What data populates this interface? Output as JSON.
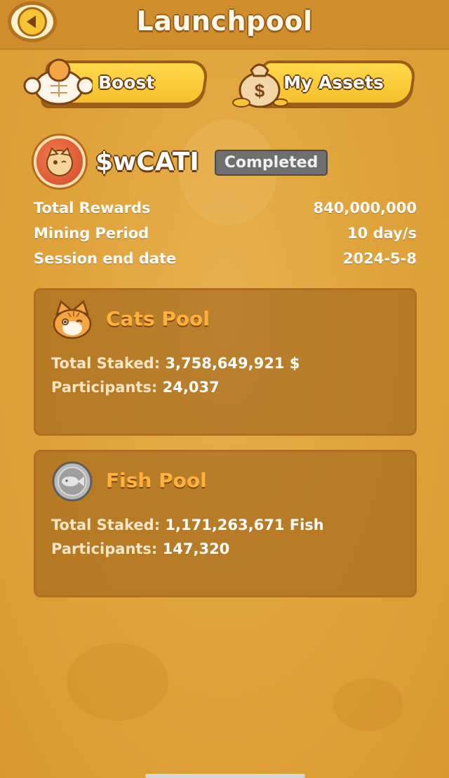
{
  "header": {
    "title": "Launchpool"
  },
  "nav": {
    "boost_label": "Boost",
    "assets_label": "My Assets"
  },
  "token": {
    "name": "$wCATI",
    "status": "Completed"
  },
  "info": [
    {
      "label": "Total Rewards",
      "value": "840,000,000"
    },
    {
      "label": "Mining Period",
      "value": "10 day/s"
    },
    {
      "label": "Session end date",
      "value": "2024-5-8"
    }
  ],
  "pools": {
    "cats": {
      "title": "Cats Pool",
      "staked_label": "Total Staked:",
      "staked_value": "3,758,649,921 $",
      "participants_label": "Participants:",
      "participants_value": "24,037"
    },
    "fish": {
      "title": "Fish Pool",
      "staked_label": "Total Staked:",
      "staked_value": "1,171,263,671 Fish",
      "participants_label": "Participants:",
      "participants_value": "147,320"
    }
  },
  "colors": {
    "background": "#e0a43c",
    "header": "#cf8d2c",
    "accent": "#ffb13a",
    "button": "#f5c12a"
  }
}
